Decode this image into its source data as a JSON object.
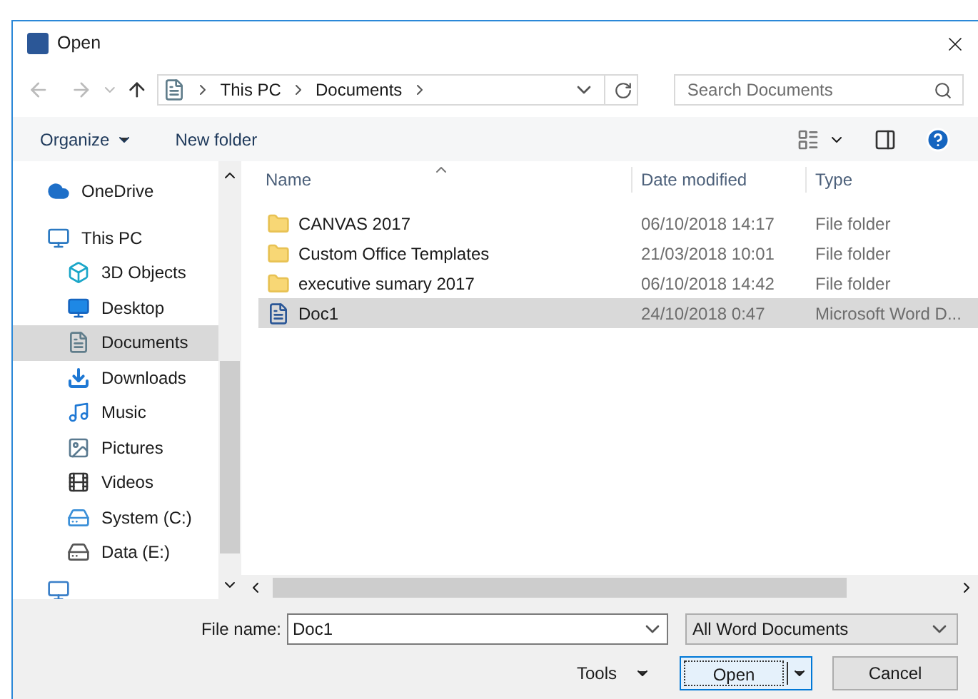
{
  "window": {
    "title": "Open"
  },
  "address": {
    "path": [
      "This PC",
      "Documents"
    ]
  },
  "search": {
    "placeholder": "Search Documents"
  },
  "toolbar": {
    "organize": "Organize",
    "new_folder": "New folder"
  },
  "nav_pane": {
    "items": [
      {
        "label": "OneDrive",
        "kind": "cloud",
        "selected": false
      },
      {
        "label": "This PC",
        "kind": "pc",
        "selected": false,
        "children": [
          {
            "label": "3D Objects",
            "kind": "cube",
            "selected": false
          },
          {
            "label": "Desktop",
            "kind": "desktop",
            "selected": false
          },
          {
            "label": "Documents",
            "kind": "documents",
            "selected": true
          },
          {
            "label": "Downloads",
            "kind": "downloads",
            "selected": false
          },
          {
            "label": "Music",
            "kind": "music",
            "selected": false
          },
          {
            "label": "Pictures",
            "kind": "pictures",
            "selected": false
          },
          {
            "label": "Videos",
            "kind": "videos",
            "selected": false
          },
          {
            "label": "System (C:)",
            "kind": "system-drive",
            "selected": false
          },
          {
            "label": "Data (E:)",
            "kind": "drive",
            "selected": false
          }
        ]
      }
    ]
  },
  "file_list": {
    "columns": [
      "Name",
      "Date modified",
      "Type"
    ],
    "rows": [
      {
        "name": "CANVAS 2017",
        "date": "06/10/2018 14:17",
        "type": "File folder",
        "kind": "folder",
        "selected": false
      },
      {
        "name": "Custom Office Templates",
        "date": "21/03/2018 10:01",
        "type": "File folder",
        "kind": "folder",
        "selected": false
      },
      {
        "name": "executive sumary 2017",
        "date": "06/10/2018 14:42",
        "type": "File folder",
        "kind": "folder",
        "selected": false
      },
      {
        "name": "Doc1",
        "date": "24/10/2018 0:47",
        "type": "Microsoft Word D...",
        "kind": "word",
        "selected": true
      }
    ]
  },
  "file_name": {
    "label": "File name:",
    "value": "Doc1"
  },
  "file_type": {
    "value": "All Word Documents"
  },
  "buttons": {
    "tools": "Tools",
    "open": "Open",
    "cancel": "Cancel"
  }
}
